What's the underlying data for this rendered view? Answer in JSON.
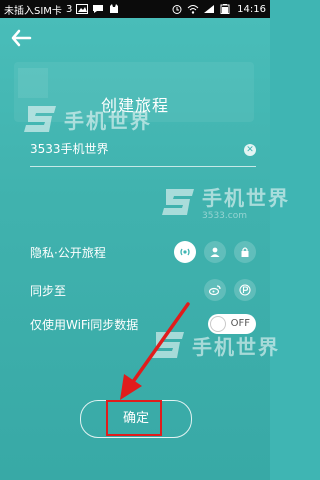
{
  "status_bar": {
    "carrier": "未插入SIM卡",
    "carrier_num": "3",
    "time": "14:16"
  },
  "header": {
    "title": "创建旅程"
  },
  "name_field": {
    "value": "3533手机世界"
  },
  "privacy_row": {
    "label": "隐私·公开旅程"
  },
  "sync_row": {
    "label": "同步至"
  },
  "wifi_row": {
    "label": "仅使用WiFi同步数据",
    "toggle_label": "OFF"
  },
  "confirm_button": {
    "label": "确定"
  },
  "watermark": {
    "brand": "手机世界",
    "url": "3533.com"
  },
  "colors": {
    "background": "#3fb5b3",
    "highlight": "#e01c1c"
  }
}
